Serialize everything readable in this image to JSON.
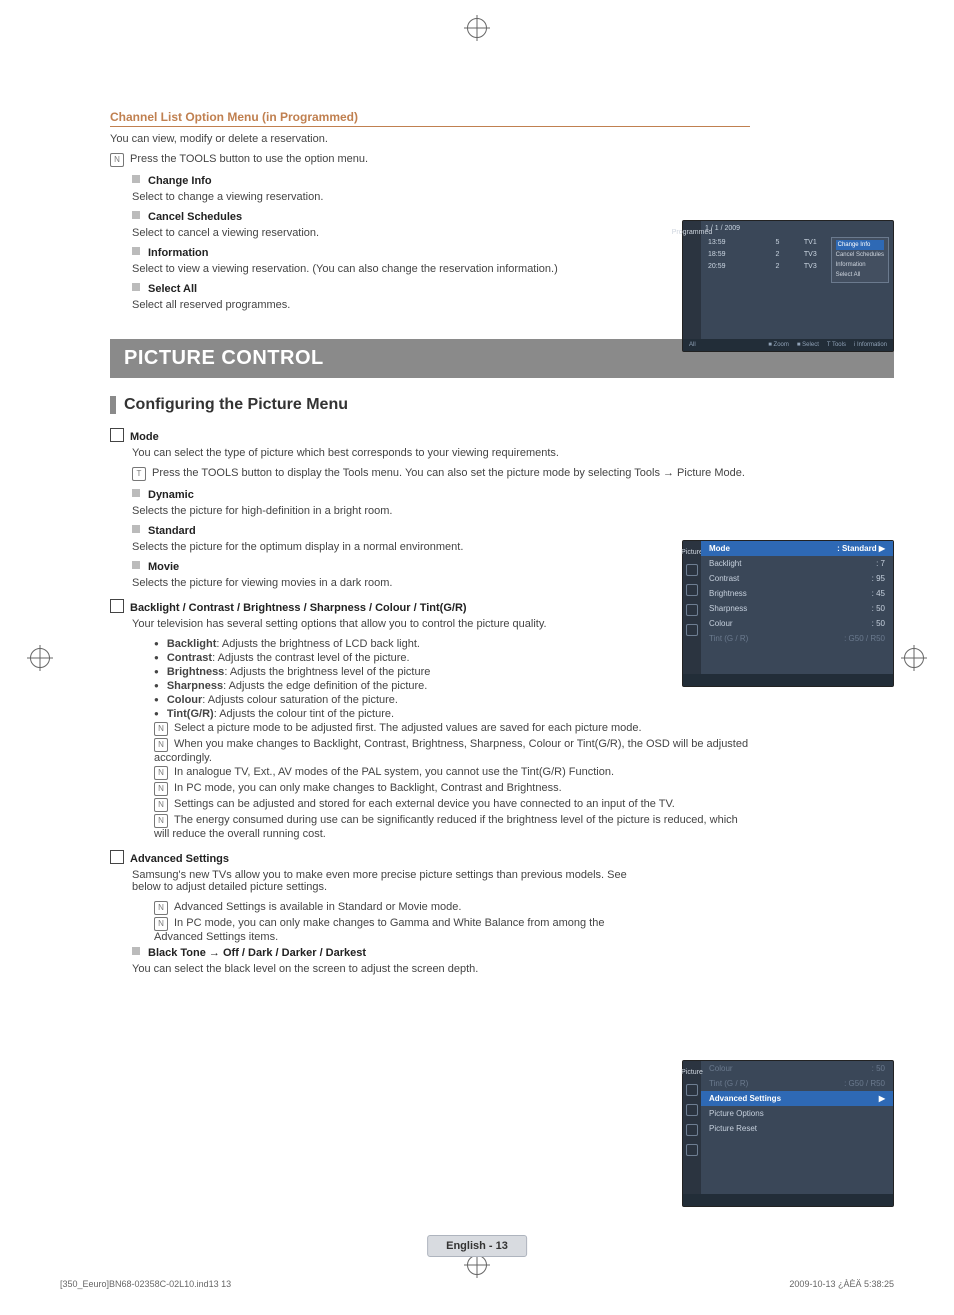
{
  "header": {
    "option_menu_title": "Channel List Option Menu (in Programmed)",
    "intro": "You can view, modify or delete a reservation.",
    "tools_line": "Press the TOOLS button to use the option menu.",
    "items": [
      {
        "title": "Change Info",
        "desc": "Select to change a viewing reservation."
      },
      {
        "title": "Cancel Schedules",
        "desc": "Select to cancel a viewing reservation."
      },
      {
        "title": "Information",
        "desc": "Select to view a viewing reservation. (You can also change the reservation information.)"
      },
      {
        "title": "Select All",
        "desc": "Select all reserved programmes."
      }
    ]
  },
  "osd1": {
    "side_label": "Programmed",
    "date": "1 / 1 / 2009",
    "rows": [
      {
        "time": "13:59",
        "num": "5",
        "ch": "TV1"
      },
      {
        "time": "18:59",
        "num": "2",
        "ch": "TV3"
      },
      {
        "time": "20:59",
        "num": "2",
        "ch": "TV3"
      }
    ],
    "popup": [
      "Change Info",
      "Cancel Schedules",
      "Information",
      "Select All"
    ],
    "foot_left": "All",
    "foot_items": [
      "■ Zoom",
      "■ Select",
      "T Tools",
      "i Information"
    ]
  },
  "banner": "PICTURE CONTROL",
  "subheading": "Configuring the Picture Menu",
  "mode": {
    "title": "Mode",
    "desc": "You can select the type of picture which best corresponds to your viewing requirements.",
    "tools_note": "Press the TOOLS button to display the Tools menu. You can also set the picture mode by selecting Tools → Picture Mode.",
    "options": [
      {
        "title": "Dynamic",
        "desc": "Selects the picture for high-definition in a bright room."
      },
      {
        "title": "Standard",
        "desc": "Selects the picture for the optimum display in a normal environment."
      },
      {
        "title": "Movie",
        "desc": "Selects the picture for viewing movies in a dark room."
      }
    ]
  },
  "osd2": {
    "side_label": "Picture",
    "rows": [
      {
        "k": "Mode",
        "v": ": Standard",
        "hl": true,
        "arrow": "▶"
      },
      {
        "k": "Backlight",
        "v": ": 7"
      },
      {
        "k": "Contrast",
        "v": ": 95"
      },
      {
        "k": "Brightness",
        "v": ": 45"
      },
      {
        "k": "Sharpness",
        "v": ": 50"
      },
      {
        "k": "Colour",
        "v": ": 50"
      },
      {
        "k": "Tint (G / R)",
        "v": ": G50 / R50",
        "dim": true
      }
    ]
  },
  "adjust": {
    "title": "Backlight / Contrast / Brightness / Sharpness / Colour / Tint(G/R)",
    "intro": "Your television has several setting options that allow you to control the picture quality.",
    "bullets": [
      {
        "b": "Backlight",
        "t": ": Adjusts the brightness of LCD back light."
      },
      {
        "b": "Contrast",
        "t": ": Adjusts the contrast level of the picture."
      },
      {
        "b": "Brightness",
        "t": ": Adjusts the brightness level of the picture"
      },
      {
        "b": "Sharpness",
        "t": ": Adjusts the edge definition of the picture."
      },
      {
        "b": "Colour",
        "t": ": Adjusts colour saturation of the picture."
      },
      {
        "b": "Tint(G/R)",
        "t": ": Adjusts the colour tint of the picture."
      }
    ],
    "notes": [
      "Select a picture mode to be adjusted first. The adjusted values are saved for each picture mode.",
      "When you make changes to Backlight, Contrast, Brightness, Sharpness, Colour or Tint(G/R), the OSD will be adjusted accordingly.",
      "In analogue TV, Ext., AV modes of the PAL system, you cannot use the Tint(G/R) Function.",
      "In PC mode, you can only make changes to Backlight, Contrast and Brightness.",
      "Settings can be adjusted and stored for each external device you have connected to an input of the TV.",
      "The energy consumed during use can be significantly reduced if the brightness level of the picture is reduced, which will reduce the overall running cost."
    ]
  },
  "advanced": {
    "title": "Advanced Settings",
    "intro": "Samsung's new TVs allow you to make even more precise picture settings than previous models. See below to adjust detailed picture settings.",
    "notes": [
      "Advanced Settings is available in Standard or Movie mode.",
      "In PC mode, you can only make changes to Gamma and White Balance from among the Advanced Settings items."
    ],
    "blacktone_title": "Black Tone → Off / Dark / Darker / Darkest",
    "blacktone_desc": "You can select the black level on the screen to adjust the screen depth."
  },
  "osd3": {
    "side_label": "Picture",
    "rows": [
      {
        "k": "Colour",
        "v": ": 50",
        "dim": true
      },
      {
        "k": "Tint (G / R)",
        "v": ": G50 / R50",
        "dim": true
      },
      {
        "k": "Advanced Settings",
        "v": "",
        "hl": true,
        "arrow": "▶"
      },
      {
        "k": "Picture Options",
        "v": ""
      },
      {
        "k": "Picture Reset",
        "v": ""
      }
    ]
  },
  "footer_badge": "English - 13",
  "footline": {
    "left": "[350_Eeuro]BN68-02358C-02L10.ind13   13",
    "right": "2009-10-13   ¿ÀÈÄ 5:38:25"
  }
}
